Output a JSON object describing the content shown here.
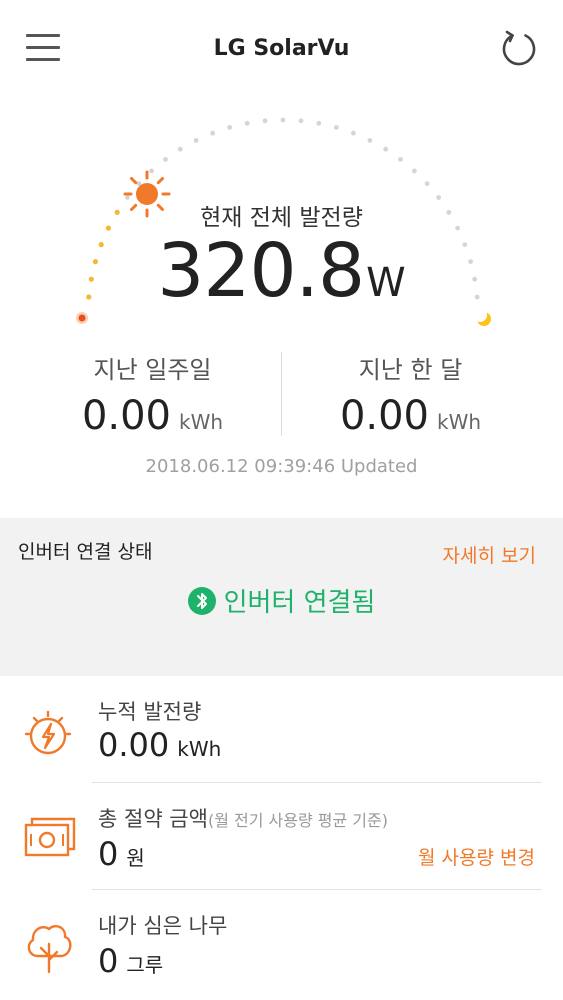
{
  "header": {
    "title": "LG SolarVu",
    "menu_icon": "hamburger-menu-icon",
    "refresh_icon": "refresh-icon"
  },
  "gauge": {
    "label": "현재 전체 발전량",
    "value": "320.8",
    "unit": "W",
    "sun_icon": "sun-icon",
    "moon_icon": "moon-icon",
    "accent_color": "#f07a2a"
  },
  "stats": {
    "week": {
      "label": "지난 일주일",
      "value": "0.00",
      "unit": "kWh"
    },
    "month": {
      "label": "지난 한 달",
      "value": "0.00",
      "unit": "kWh"
    }
  },
  "updated": "2018.06.12 09:39:46 Updated",
  "inverter": {
    "title": "인버터 연결 상태",
    "detail_link": "자세히 보기",
    "status": "인버터 연결됨",
    "status_icon": "bluetooth-icon",
    "status_color": "#1fb26b"
  },
  "summary": {
    "generation": {
      "label": "누적 발전량",
      "value": "0.00",
      "unit": "kWh",
      "icon": "solar-power-icon"
    },
    "savings": {
      "label": "총 절약 금액",
      "sublabel": "(월 전기 사용량 평균 기준)",
      "value": "0",
      "unit": "원",
      "link": "월 사용량 변경",
      "icon": "money-icon"
    },
    "trees": {
      "label": "내가 심은 나무",
      "value": "0",
      "unit": "그루",
      "icon": "tree-icon"
    }
  }
}
